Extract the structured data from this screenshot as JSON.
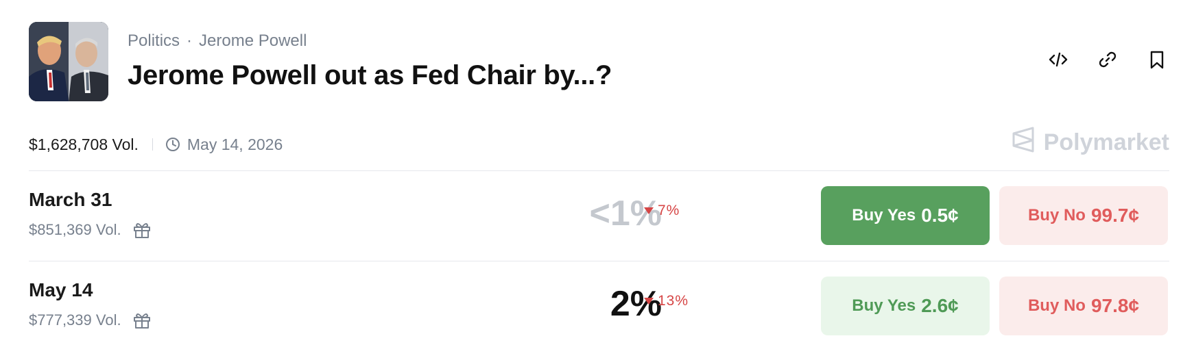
{
  "market": {
    "breadcrumb": [
      "Politics",
      "Jerome Powell"
    ],
    "breadcrumb_separator": "·",
    "title": "Jerome Powell out as Fed Chair by...?",
    "thumbnail_icon": "market-image-two-faces"
  },
  "actions": [
    {
      "name": "embed-code-icon"
    },
    {
      "name": "copy-link-icon"
    },
    {
      "name": "bookmark-icon"
    }
  ],
  "meta": {
    "volume": "$1,628,708 Vol.",
    "end_date": "May 14, 2026"
  },
  "brand": {
    "name": "Polymarket"
  },
  "outcomes": [
    {
      "name": "March 31",
      "volume": "$851,369 Vol.",
      "probability": "<1%",
      "change": "7%",
      "change_direction": "down",
      "buy_yes_label": "Buy Yes",
      "buy_yes_price": "0.5¢",
      "buy_no_label": "Buy No",
      "buy_no_price": "99.7¢",
      "selected": true
    },
    {
      "name": "May 14",
      "volume": "$777,339 Vol.",
      "probability": "2%",
      "change": "13%",
      "change_direction": "down",
      "buy_yes_label": "Buy Yes",
      "buy_yes_price": "2.6¢",
      "buy_no_label": "Buy No",
      "buy_no_price": "97.8¢",
      "selected": false
    }
  ],
  "colors": {
    "yes_solid": "#58a05e",
    "yes_soft": "#e9f6ea",
    "no_soft": "#fbeceb",
    "no_text": "#e05c5c",
    "down": "#d64545",
    "muted": "#77808d"
  }
}
